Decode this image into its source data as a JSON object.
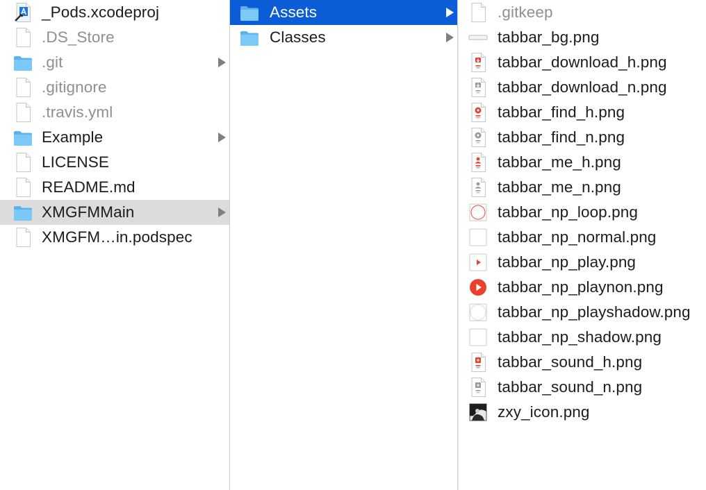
{
  "columns": [
    {
      "items": [
        {
          "label": "_Pods.xcodeproj",
          "icon": "xcodeproj-icon",
          "dim": false,
          "arrow": false,
          "selected": null
        },
        {
          "label": ".DS_Store",
          "icon": "file-icon",
          "dim": true,
          "arrow": false,
          "selected": null
        },
        {
          "label": ".git",
          "icon": "folder-icon",
          "dim": true,
          "arrow": true,
          "selected": null
        },
        {
          "label": ".gitignore",
          "icon": "file-icon",
          "dim": true,
          "arrow": false,
          "selected": null
        },
        {
          "label": ".travis.yml",
          "icon": "file-icon",
          "dim": true,
          "arrow": false,
          "selected": null
        },
        {
          "label": "Example",
          "icon": "folder-icon",
          "dim": false,
          "arrow": true,
          "selected": null
        },
        {
          "label": "LICENSE",
          "icon": "file-icon",
          "dim": false,
          "arrow": false,
          "selected": null
        },
        {
          "label": "README.md",
          "icon": "file-icon",
          "dim": false,
          "arrow": false,
          "selected": null
        },
        {
          "label": "XMGFMMain",
          "icon": "folder-icon",
          "dim": false,
          "arrow": true,
          "selected": "inactive"
        },
        {
          "label": "XMGFM…in.podspec",
          "icon": "file-icon",
          "dim": false,
          "arrow": false,
          "selected": null
        }
      ]
    },
    {
      "items": [
        {
          "label": "Assets",
          "icon": "folder-icon",
          "dim": false,
          "arrow": true,
          "selected": "active"
        },
        {
          "label": "Classes",
          "icon": "folder-icon",
          "dim": false,
          "arrow": true,
          "selected": null
        }
      ]
    },
    {
      "items": [
        {
          "label": ".gitkeep",
          "icon": "file-icon",
          "dim": true,
          "arrow": false,
          "selected": null
        },
        {
          "label": "tabbar_bg.png",
          "icon": "image-bar-thumbnail-icon",
          "dim": false,
          "arrow": false,
          "selected": null
        },
        {
          "label": "tabbar_download_h.png",
          "icon": "image-download-red-icon",
          "dim": false,
          "arrow": false,
          "selected": null
        },
        {
          "label": "tabbar_download_n.png",
          "icon": "image-download-gray-icon",
          "dim": false,
          "arrow": false,
          "selected": null
        },
        {
          "label": "tabbar_find_h.png",
          "icon": "image-find-red-icon",
          "dim": false,
          "arrow": false,
          "selected": null
        },
        {
          "label": "tabbar_find_n.png",
          "icon": "image-find-gray-icon",
          "dim": false,
          "arrow": false,
          "selected": null
        },
        {
          "label": "tabbar_me_h.png",
          "icon": "image-me-red-icon",
          "dim": false,
          "arrow": false,
          "selected": null
        },
        {
          "label": "tabbar_me_n.png",
          "icon": "image-me-gray-icon",
          "dim": false,
          "arrow": false,
          "selected": null
        },
        {
          "label": "tabbar_np_loop.png",
          "icon": "image-loop-icon",
          "dim": false,
          "arrow": false,
          "selected": null
        },
        {
          "label": "tabbar_np_normal.png",
          "icon": "image-normal-icon",
          "dim": false,
          "arrow": false,
          "selected": null
        },
        {
          "label": "tabbar_np_play.png",
          "icon": "image-play-icon",
          "dim": false,
          "arrow": false,
          "selected": null
        },
        {
          "label": "tabbar_np_playnon.png",
          "icon": "image-playnon-icon",
          "dim": false,
          "arrow": false,
          "selected": null
        },
        {
          "label": "tabbar_np_playshadow.png",
          "icon": "image-playshadow-icon",
          "dim": false,
          "arrow": false,
          "selected": null
        },
        {
          "label": "tabbar_np_shadow.png",
          "icon": "image-shadow-icon",
          "dim": false,
          "arrow": false,
          "selected": null
        },
        {
          "label": "tabbar_sound_h.png",
          "icon": "image-sound-red-icon",
          "dim": false,
          "arrow": false,
          "selected": null
        },
        {
          "label": "tabbar_sound_n.png",
          "icon": "image-sound-gray-icon",
          "dim": false,
          "arrow": false,
          "selected": null
        },
        {
          "label": "zxy_icon.png",
          "icon": "image-photo-icon",
          "dim": false,
          "arrow": false,
          "selected": null
        }
      ]
    }
  ],
  "colors": {
    "selection_active": "#0b5dd7",
    "selection_inactive": "#dcdcdc",
    "folder": "#5fb9f2",
    "dim_text": "#8f8f8f",
    "accent_red": "#e8412c"
  }
}
